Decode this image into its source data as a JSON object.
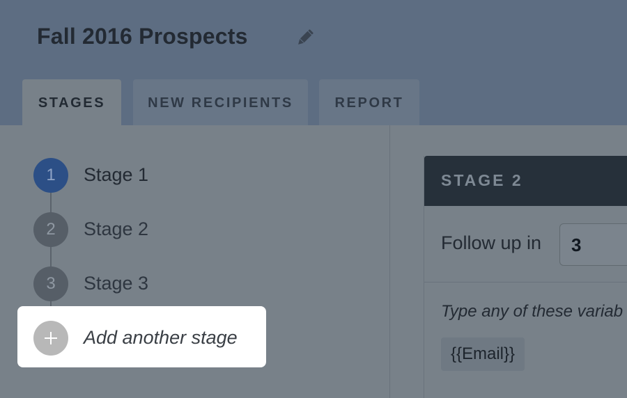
{
  "header": {
    "title": "Fall 2016 Prospects",
    "edit_icon": "pencil-icon"
  },
  "tabs": [
    {
      "label": "STAGES",
      "active": true
    },
    {
      "label": "NEW RECIPIENTS",
      "active": false
    },
    {
      "label": "REPORT",
      "active": false
    }
  ],
  "stages": [
    {
      "number": "1",
      "label": "Stage 1",
      "active": true
    },
    {
      "number": "2",
      "label": "Stage 2",
      "active": false
    },
    {
      "number": "3",
      "label": "Stage 3",
      "active": false
    }
  ],
  "add_stage": {
    "label": "Add another stage",
    "icon": "plus-icon"
  },
  "panel": {
    "title": "STAGE 2",
    "follow_label": "Follow up in",
    "follow_value": "3",
    "variables_text": "Type any of these variab",
    "variables": [
      "{{Email}}"
    ]
  },
  "colors": {
    "header_bg": "#5d6d82",
    "active_stage": "#2c4f86",
    "panel_header": "#26303a",
    "highlight": "#ffffff"
  }
}
